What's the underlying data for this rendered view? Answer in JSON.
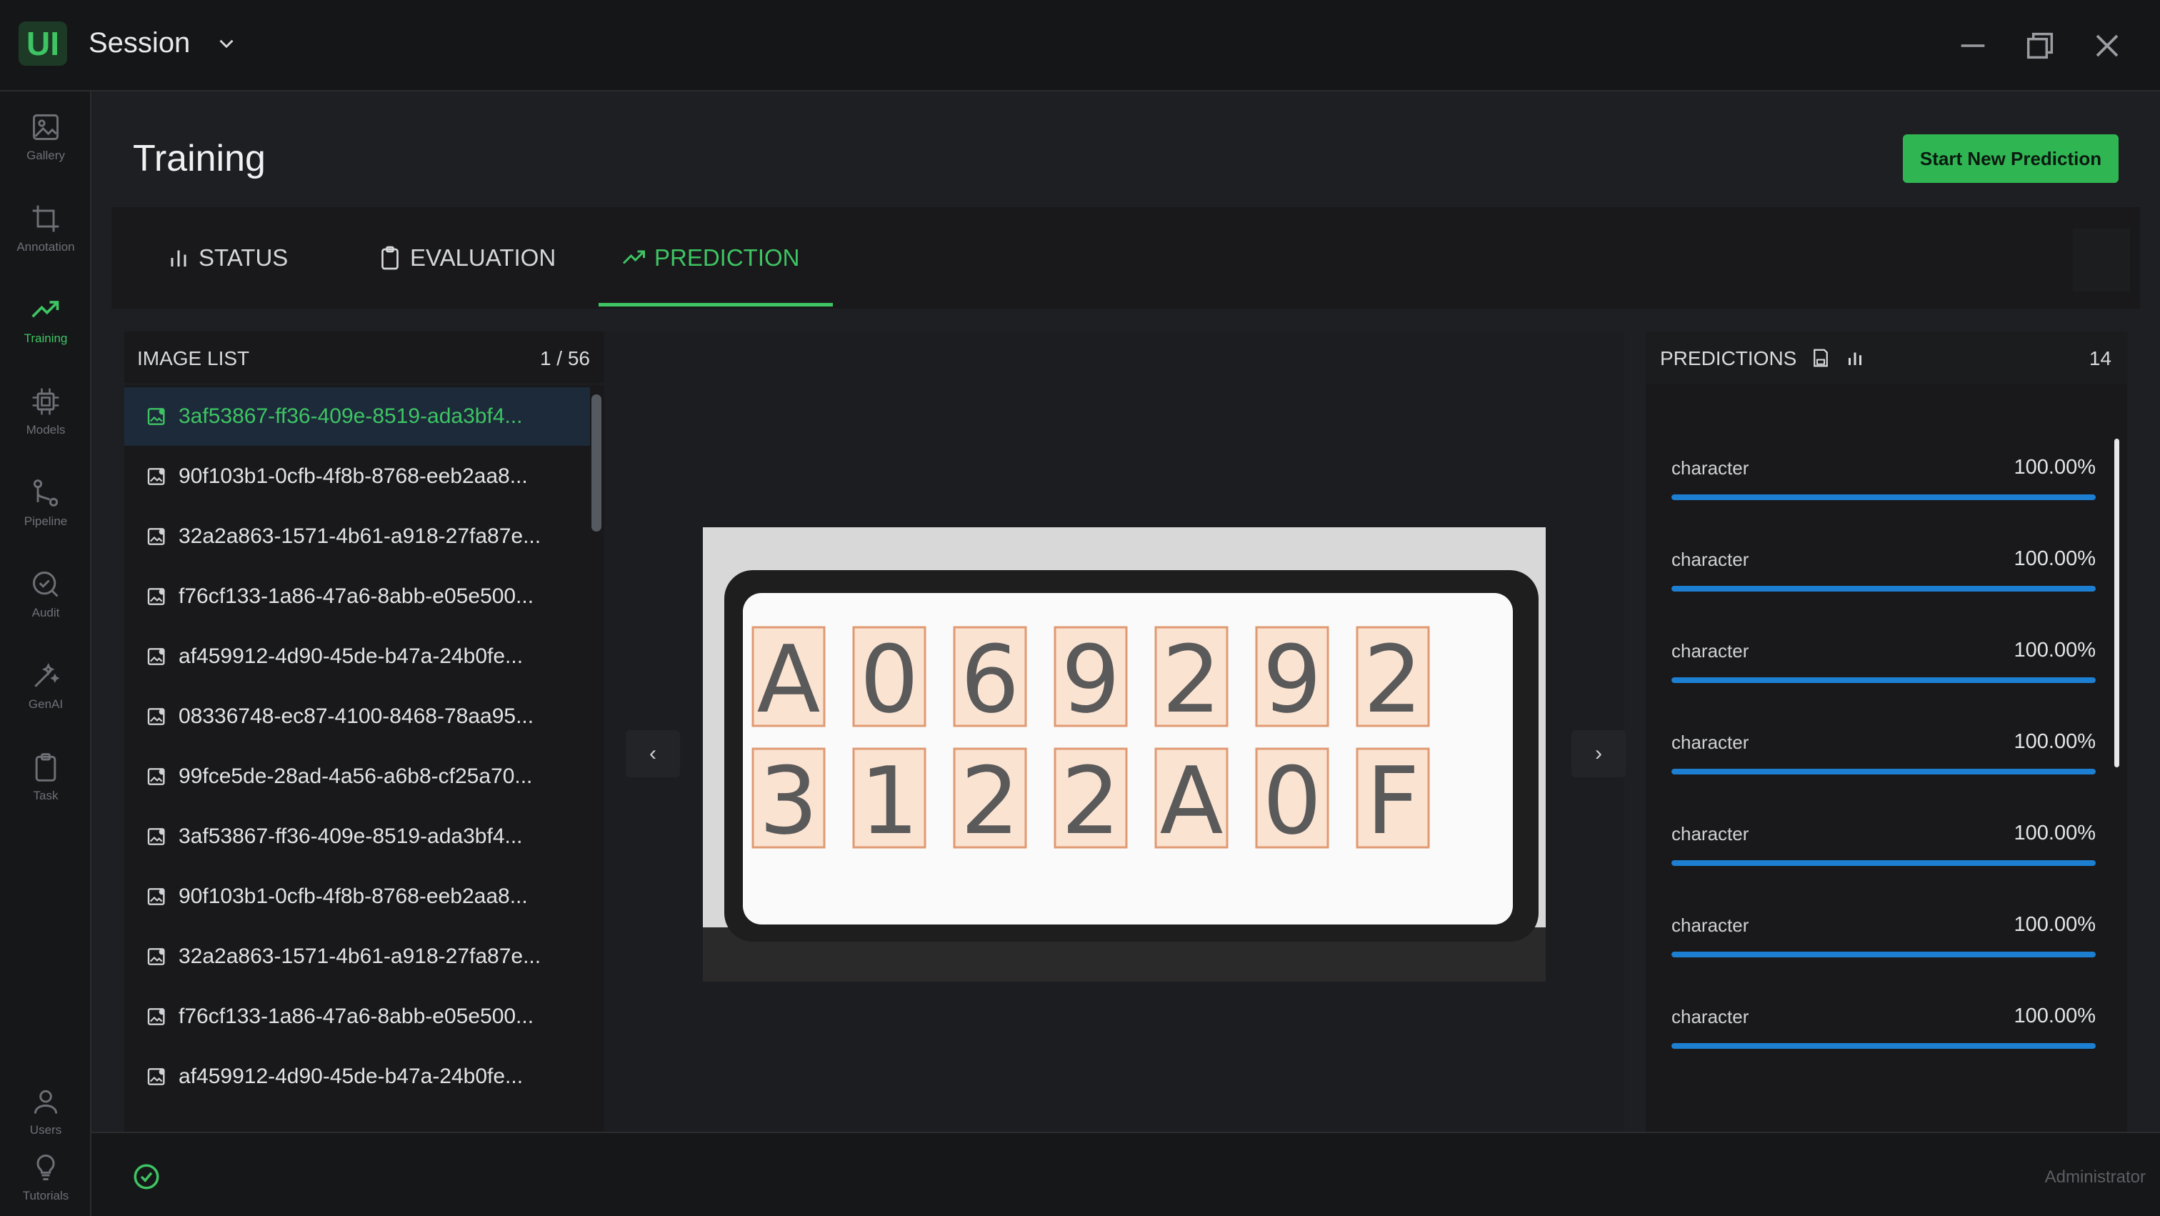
{
  "app": {
    "logo": "UI",
    "session_label": "Session"
  },
  "window_controls": [
    "minimize-icon",
    "restore-icon",
    "close-icon"
  ],
  "sidebar": {
    "items": [
      {
        "label": "Gallery",
        "icon": "image-icon",
        "active": false
      },
      {
        "label": "Annotation",
        "icon": "crop-icon",
        "active": false
      },
      {
        "label": "Training",
        "icon": "trend-icon",
        "active": true
      },
      {
        "label": "Models",
        "icon": "chip-icon",
        "active": false
      },
      {
        "label": "Pipeline",
        "icon": "pipeline-icon",
        "active": false
      },
      {
        "label": "Audit",
        "icon": "audit-icon",
        "active": false
      },
      {
        "label": "GenAI",
        "icon": "wand-icon",
        "active": false
      },
      {
        "label": "Task",
        "icon": "clipboard-icon",
        "active": false
      }
    ],
    "bottom_items": [
      {
        "label": "Users",
        "icon": "user-icon"
      },
      {
        "label": "Tutorials",
        "icon": "lightbulb-icon"
      }
    ]
  },
  "page": {
    "title": "Training",
    "start_button": "Start New Prediction"
  },
  "tabs": [
    {
      "label": "STATUS",
      "icon": "bar-chart-icon",
      "active": false
    },
    {
      "label": "EVALUATION",
      "icon": "clipboard-icon",
      "active": false
    },
    {
      "label": "PREDICTION",
      "icon": "trend-icon",
      "active": true
    }
  ],
  "image_list": {
    "title": "IMAGE LIST",
    "count": "1 / 56",
    "items": [
      "3af53867-ff36-409e-8519-ada3bf4...",
      "90f103b1-0cfb-4f8b-8768-eeb2aa8...",
      "32a2a863-1571-4b61-a918-27fa87e...",
      "f76cf133-1a86-47a6-8abb-e05e500...",
      "af459912-4d90-45de-b47a-24b0fe...",
      "08336748-ec87-4100-8468-78aa95...",
      "99fce5de-28ad-4a56-a6b8-cf25a70...",
      "3af53867-ff36-409e-8519-ada3bf4...",
      "90f103b1-0cfb-4f8b-8768-eeb2aa8...",
      "32a2a863-1571-4b61-a918-27fa87e...",
      "f76cf133-1a86-47a6-8abb-e05e500...",
      "af459912-4d90-45de-b47a-24b0fe..."
    ],
    "selected_index": 0
  },
  "viewer": {
    "prev": "‹",
    "next": "›",
    "plate_rows": [
      [
        "A",
        "0",
        "6",
        "9",
        "2",
        "9",
        "2"
      ],
      [
        "3",
        "1",
        "2",
        "2",
        "A",
        "0",
        "F"
      ]
    ]
  },
  "predictions": {
    "title": "PREDICTIONS",
    "count": "14",
    "items": [
      {
        "label": "character",
        "value": "100.00%",
        "fraction": 1.0
      },
      {
        "label": "character",
        "value": "100.00%",
        "fraction": 1.0
      },
      {
        "label": "character",
        "value": "100.00%",
        "fraction": 1.0
      },
      {
        "label": "character",
        "value": "100.00%",
        "fraction": 1.0
      },
      {
        "label": "character",
        "value": "100.00%",
        "fraction": 1.0
      },
      {
        "label": "character",
        "value": "100.00%",
        "fraction": 1.0
      },
      {
        "label": "character",
        "value": "100.00%",
        "fraction": 1.0
      }
    ]
  },
  "statusbar": {
    "user": "Administrator"
  },
  "colors": {
    "accent": "#3ec463",
    "bar": "#1d7fd1",
    "selected_row": "#1c2a3a"
  }
}
